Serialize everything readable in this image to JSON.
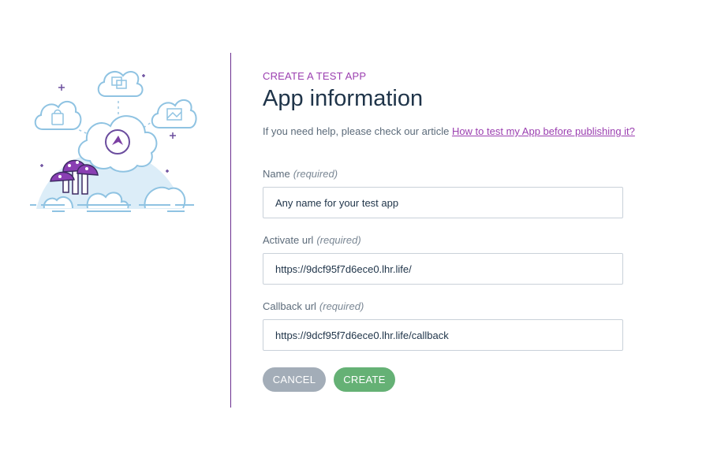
{
  "header": {
    "eyebrow": "CREATE A TEST APP",
    "title": "App information",
    "help_text": "If you need help, please check our article ",
    "help_link": "How to test my App before publishing it?"
  },
  "form": {
    "name": {
      "label": "Name",
      "required": "(required)",
      "value": "Any name for your test app"
    },
    "activate_url": {
      "label": "Activate url",
      "required": "(required)",
      "value": "https://9dcf95f7d6ece0.lhr.life/"
    },
    "callback_url": {
      "label": "Callback url",
      "required": "(required)",
      "value": "https://9dcf95f7d6ece0.lhr.life/callback"
    }
  },
  "actions": {
    "cancel_label": "CANCEL",
    "create_label": "CREATE"
  },
  "colors": {
    "accent": "#9b3fb0",
    "divider": "#6b2f8f",
    "title": "#1f3449",
    "cancel": "#a3adb8",
    "create": "#65b175"
  },
  "icons": [
    "cloud-illustration",
    "shopping-bag-icon",
    "chat-bubbles-icon",
    "image-icon",
    "brand-logo-icon",
    "mushrooms-illustration"
  ]
}
